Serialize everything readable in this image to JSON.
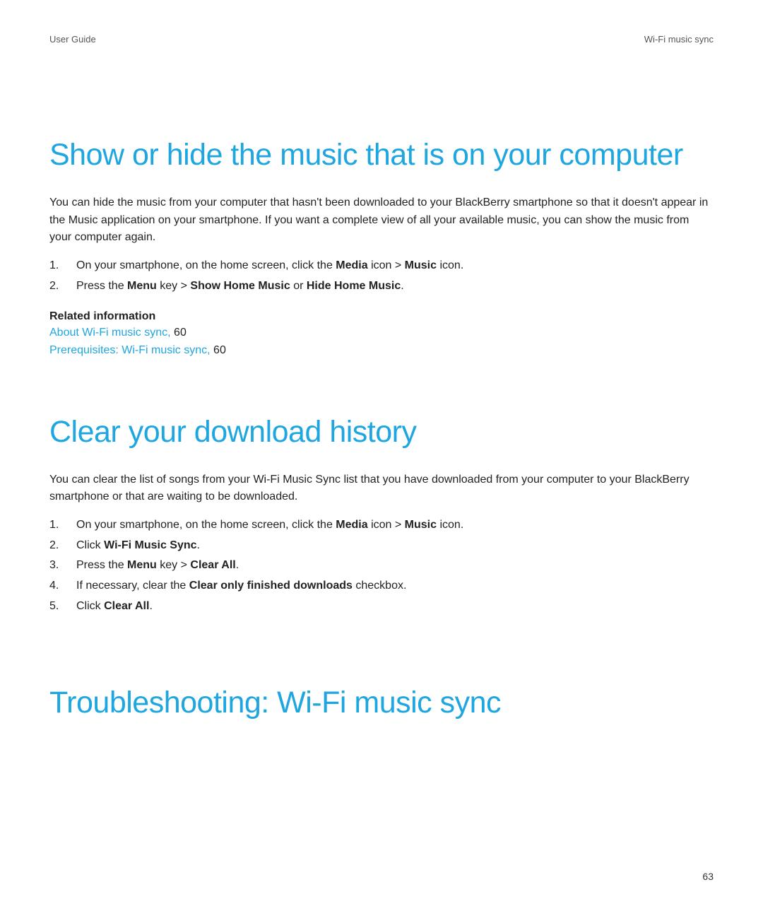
{
  "header": {
    "left": "User Guide",
    "right": "Wi-Fi music sync"
  },
  "section1": {
    "heading": "Show or hide the music that is on your computer",
    "intro": "You can hide the music from your computer that hasn't been downloaded to your BlackBerry smartphone so that it doesn't appear in the Music application on your smartphone. If you want a complete view of all your available music, you can show the music from your computer again.",
    "steps": [
      {
        "pre": "On your smartphone, on the home screen, click the ",
        "b1": "Media",
        "mid1": " icon > ",
        "b2": "Music",
        "post": " icon."
      },
      {
        "pre": "Press the ",
        "b1": "Menu",
        "mid1": " key > ",
        "b2": "Show Home Music",
        "mid2": " or ",
        "b3": "Hide Home Music",
        "post": "."
      }
    ],
    "related": {
      "heading": "Related information",
      "links": [
        {
          "text": "About Wi-Fi music sync,",
          "page": " 60"
        },
        {
          "text": "Prerequisites: Wi-Fi music sync,",
          "page": " 60"
        }
      ]
    }
  },
  "section2": {
    "heading": "Clear your download history",
    "intro": "You can clear the list of songs from your Wi-Fi Music Sync list that you have downloaded from your computer to your BlackBerry smartphone or that are waiting to be downloaded.",
    "steps": [
      {
        "pre": "On your smartphone, on the home screen, click the ",
        "b1": "Media",
        "mid1": " icon > ",
        "b2": "Music",
        "post": " icon."
      },
      {
        "pre": "Click ",
        "b1": "Wi-Fi Music Sync",
        "post": "."
      },
      {
        "pre": "Press the ",
        "b1": "Menu",
        "mid1": " key > ",
        "b2": "Clear All",
        "post": "."
      },
      {
        "pre": "If necessary, clear the ",
        "b1": "Clear only finished downloads",
        "post": " checkbox."
      },
      {
        "pre": "Click ",
        "b1": "Clear All",
        "post": "."
      }
    ]
  },
  "section3": {
    "heading": "Troubleshooting: Wi-Fi music sync"
  },
  "pageNumber": "63"
}
